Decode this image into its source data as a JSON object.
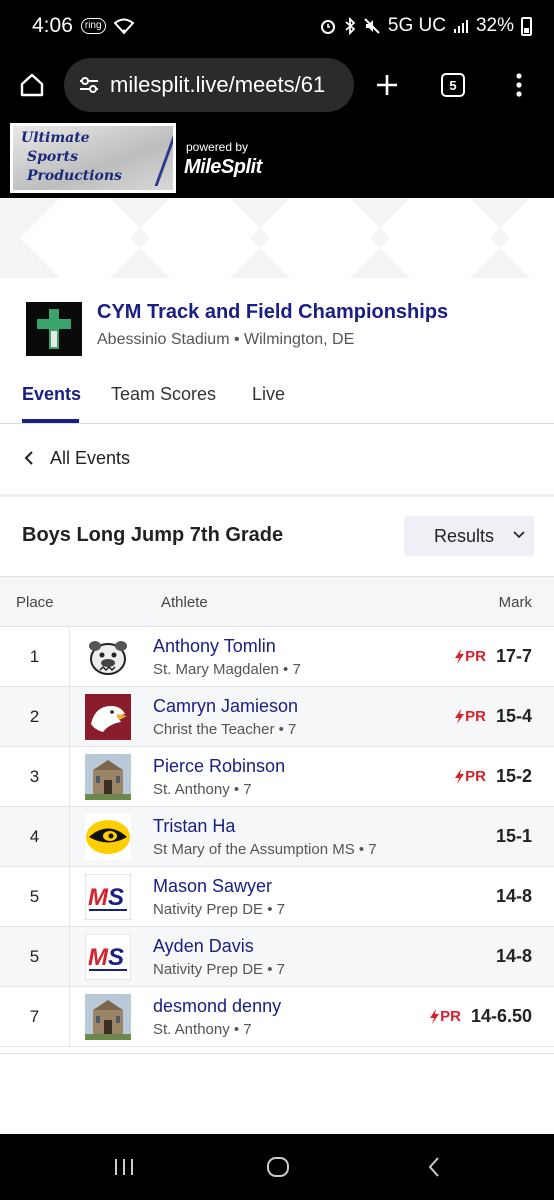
{
  "status_bar": {
    "time": "4:06",
    "ring_label": "ring",
    "network": "5G UC",
    "battery": "32%"
  },
  "browser": {
    "url": "milesplit.live/meets/61",
    "tab_count": "5"
  },
  "banner": {
    "logo_lines": [
      "Ultimate",
      "Sports",
      "Productions"
    ],
    "powered_by": "powered by",
    "brand": "MileSplit"
  },
  "meet": {
    "title": "CYM Track and Field Championships",
    "location": "Abessinio Stadium • Wilmington, DE"
  },
  "tabs": [
    {
      "label": "Events",
      "active": true
    },
    {
      "label": "Team Scores",
      "active": false
    },
    {
      "label": "Live",
      "active": false
    }
  ],
  "nav": {
    "all_events": "All Events"
  },
  "event": {
    "title": "Boys Long Jump 7th Grade",
    "view_select": "Results"
  },
  "table": {
    "headers": {
      "place": "Place",
      "athlete": "Athlete",
      "mark": "Mark"
    },
    "pr_label": "PR",
    "rows": [
      {
        "place": "1",
        "name": "Anthony Tomlin",
        "team": "St. Mary Magdalen • 7",
        "mark": "17-7",
        "pr": true,
        "logo": "bulldog-logo"
      },
      {
        "place": "2",
        "name": "Camryn Jamieson",
        "team": "Christ the Teacher • 7",
        "mark": "15-4",
        "pr": true,
        "logo": "eagle-logo"
      },
      {
        "place": "3",
        "name": "Pierce Robinson",
        "team": "St. Anthony • 7",
        "mark": "15-2",
        "pr": true,
        "logo": "church-logo"
      },
      {
        "place": "4",
        "name": "Tristan Ha",
        "team": "St Mary of the Assumption MS • 7",
        "mark": "15-1",
        "pr": false,
        "logo": "hawkeye-logo"
      },
      {
        "place": "5",
        "name": "Mason Sawyer",
        "team": "Nativity Prep DE • 7",
        "mark": "14-8",
        "pr": false,
        "logo": "ms-logo"
      },
      {
        "place": "5",
        "name": "Ayden Davis",
        "team": "Nativity Prep DE • 7",
        "mark": "14-8",
        "pr": false,
        "logo": "ms-logo"
      },
      {
        "place": "7",
        "name": "desmond denny",
        "team": "St. Anthony • 7",
        "mark": "14-6.50",
        "pr": true,
        "logo": "church-logo"
      }
    ]
  },
  "colors": {
    "brand_navy": "#1a2083",
    "pr_red": "#d6212f"
  }
}
